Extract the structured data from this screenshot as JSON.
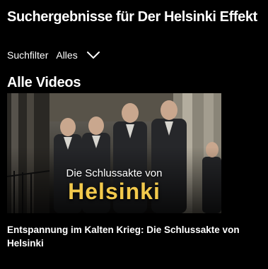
{
  "page": {
    "title": "Suchergebnisse für Der Helsinki Effekt"
  },
  "filter": {
    "label": "Suchfilter",
    "selected": "Alles",
    "icon": "chevron-down-icon"
  },
  "section": {
    "title": "Alle Videos"
  },
  "videos": [
    {
      "overlay_subtitle": "Die Schlussakte von",
      "overlay_title": "Helsinki",
      "title": "Entspannung im Kalten Krieg: Die Schlussakte von Helsinki"
    }
  ],
  "colors": {
    "background": "#000000",
    "text": "#ffffff",
    "overlay_title": "#f2c94c"
  }
}
